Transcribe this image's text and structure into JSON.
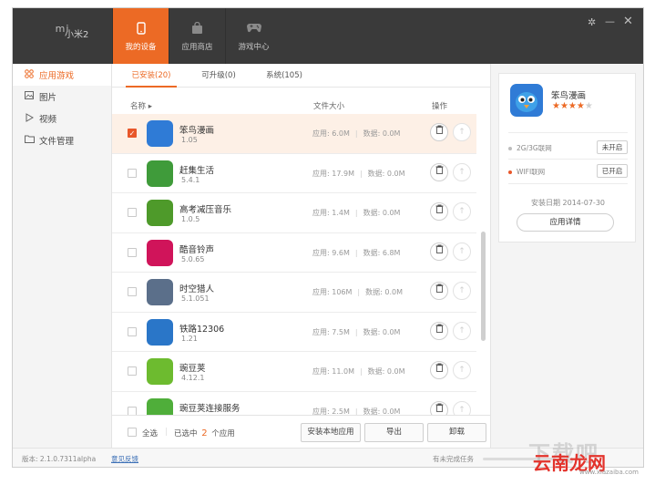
{
  "device": {
    "name": "小米2"
  },
  "nav": [
    {
      "label": "我的设备",
      "icon": "phone-icon",
      "active": true
    },
    {
      "label": "应用商店",
      "icon": "shopping-bag-icon",
      "active": false
    },
    {
      "label": "游戏中心",
      "icon": "gamepad-icon",
      "active": false
    }
  ],
  "sidebar": [
    {
      "label": "应用游戏",
      "icon": "apps-grid-icon"
    },
    {
      "label": "图片",
      "icon": "image-icon"
    },
    {
      "label": "视频",
      "icon": "play-icon"
    },
    {
      "label": "文件管理",
      "icon": "folder-icon"
    }
  ],
  "subtabs": [
    "已安装(20)",
    "可升级(0)",
    "系统(105)"
  ],
  "table": {
    "col_name": "名称",
    "col_size": "文件大小",
    "col_action": "操作",
    "app_label": "应用:",
    "data_label": "数据:",
    "rows": [
      {
        "name": "笨鸟漫画",
        "version": "1.05",
        "app_size": "6.0M",
        "data_size": "0.0M",
        "selected": true,
        "color": "#2f7bd6"
      },
      {
        "name": "赶集生活",
        "version": "5.4.1",
        "app_size": "17.9M",
        "data_size": "0.0M",
        "selected": false,
        "color": "#3f9b3a"
      },
      {
        "name": "高考减压音乐",
        "version": "1.0.5",
        "app_size": "1.4M",
        "data_size": "0.0M",
        "selected": false,
        "color": "#4e9a2a"
      },
      {
        "name": "酷音铃声",
        "version": "5.0.65",
        "app_size": "9.6M",
        "data_size": "6.8M",
        "selected": false,
        "color": "#d0145a"
      },
      {
        "name": "时空猎人",
        "version": "5.1.051",
        "app_size": "106M",
        "data_size": "0.0M",
        "selected": false,
        "color": "#5b6f8a"
      },
      {
        "name": "铁路12306",
        "version": "1.21",
        "app_size": "7.5M",
        "data_size": "0.0M",
        "selected": false,
        "color": "#2a76c8"
      },
      {
        "name": "豌豆荚",
        "version": "4.12.1",
        "app_size": "11.0M",
        "data_size": "0.0M",
        "selected": false,
        "color": "#6dbb2f"
      },
      {
        "name": "豌豆荚连接服务",
        "version": "",
        "app_size": "2.5M",
        "data_size": "0.0M",
        "selected": false,
        "color": "#4fae3a"
      }
    ]
  },
  "bottom": {
    "select_all": "全选",
    "selected_prefix": "已选中",
    "selected_count": "2",
    "selected_suffix": "个应用",
    "install_local": "安装本地应用",
    "export": "导出",
    "uninstall": "卸载"
  },
  "detail": {
    "name": "笨鸟漫画",
    "stars": 4,
    "network_2g3g": "2G/3G联网",
    "network_2g3g_btn": "未开启",
    "network_wifi": "WIFI联网",
    "network_wifi_btn": "已开启",
    "install_date": "安装日期 2014-07-30",
    "detail_btn": "应用详情"
  },
  "status": {
    "version": "版本: 2.1.0.7311alpha",
    "feedback": "意见反馈",
    "tasks": "有未完成任务"
  },
  "watermark": {
    "line1": "下载吧",
    "line2": "云南龙网",
    "line3": "www.xiazaiba.com"
  },
  "colors": {
    "accent": "#ec6a25",
    "topbar": "#3a3a3a"
  }
}
